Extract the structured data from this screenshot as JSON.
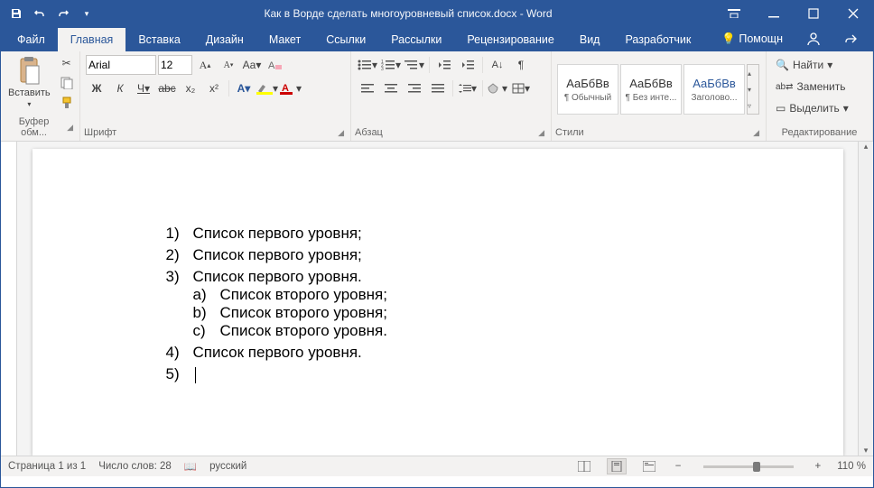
{
  "title": "Как в Ворде сделать многоуровневый список.docx - Word",
  "tabs": {
    "file": "Файл",
    "home": "Главная",
    "insert": "Вставка",
    "design": "Дизайн",
    "layout": "Макет",
    "references": "Ссылки",
    "mailings": "Рассылки",
    "review": "Рецензирование",
    "view": "Вид",
    "developer": "Разработчик",
    "help": "Помощн"
  },
  "ribbon_signin": "",
  "clipboard": {
    "paste": "Вставить",
    "group": "Буфер обм..."
  },
  "font": {
    "group": "Шрифт",
    "family": "Arial",
    "size": "12",
    "bold": "Ж",
    "italic": "К",
    "underline": "Ч",
    "strike": "abc",
    "sub": "x₂",
    "sup": "x²",
    "Aa": "Aa"
  },
  "paragraph": {
    "group": "Абзац"
  },
  "styles": {
    "group": "Стили",
    "items": [
      {
        "preview": "АаБбВв",
        "name": "¶ Обычный"
      },
      {
        "preview": "АаБбВв",
        "name": "¶ Без инте..."
      },
      {
        "preview": "АаБбВв",
        "name": "Заголово..."
      }
    ]
  },
  "editing": {
    "group": "Редактирование",
    "find": "Найти",
    "replace": "Заменить",
    "select": "Выделить"
  },
  "document": {
    "l1": [
      {
        "n": "1",
        "t": "Список первого уровня;"
      },
      {
        "n": "2",
        "t": "Список первого уровня;"
      },
      {
        "n": "3",
        "t": "Список первого уровня.",
        "children": [
          {
            "n": "a",
            "t": "Список второго уровня;"
          },
          {
            "n": "b",
            "t": "Список второго уровня;"
          },
          {
            "n": "c",
            "t": "Список второго уровня."
          }
        ]
      },
      {
        "n": "4",
        "t": "Список первого уровня."
      },
      {
        "n": "5",
        "t": ""
      }
    ]
  },
  "status": {
    "page": "Страница 1 из 1",
    "words": "Число слов: 28",
    "lang": "русский",
    "zoom": "110 %"
  }
}
